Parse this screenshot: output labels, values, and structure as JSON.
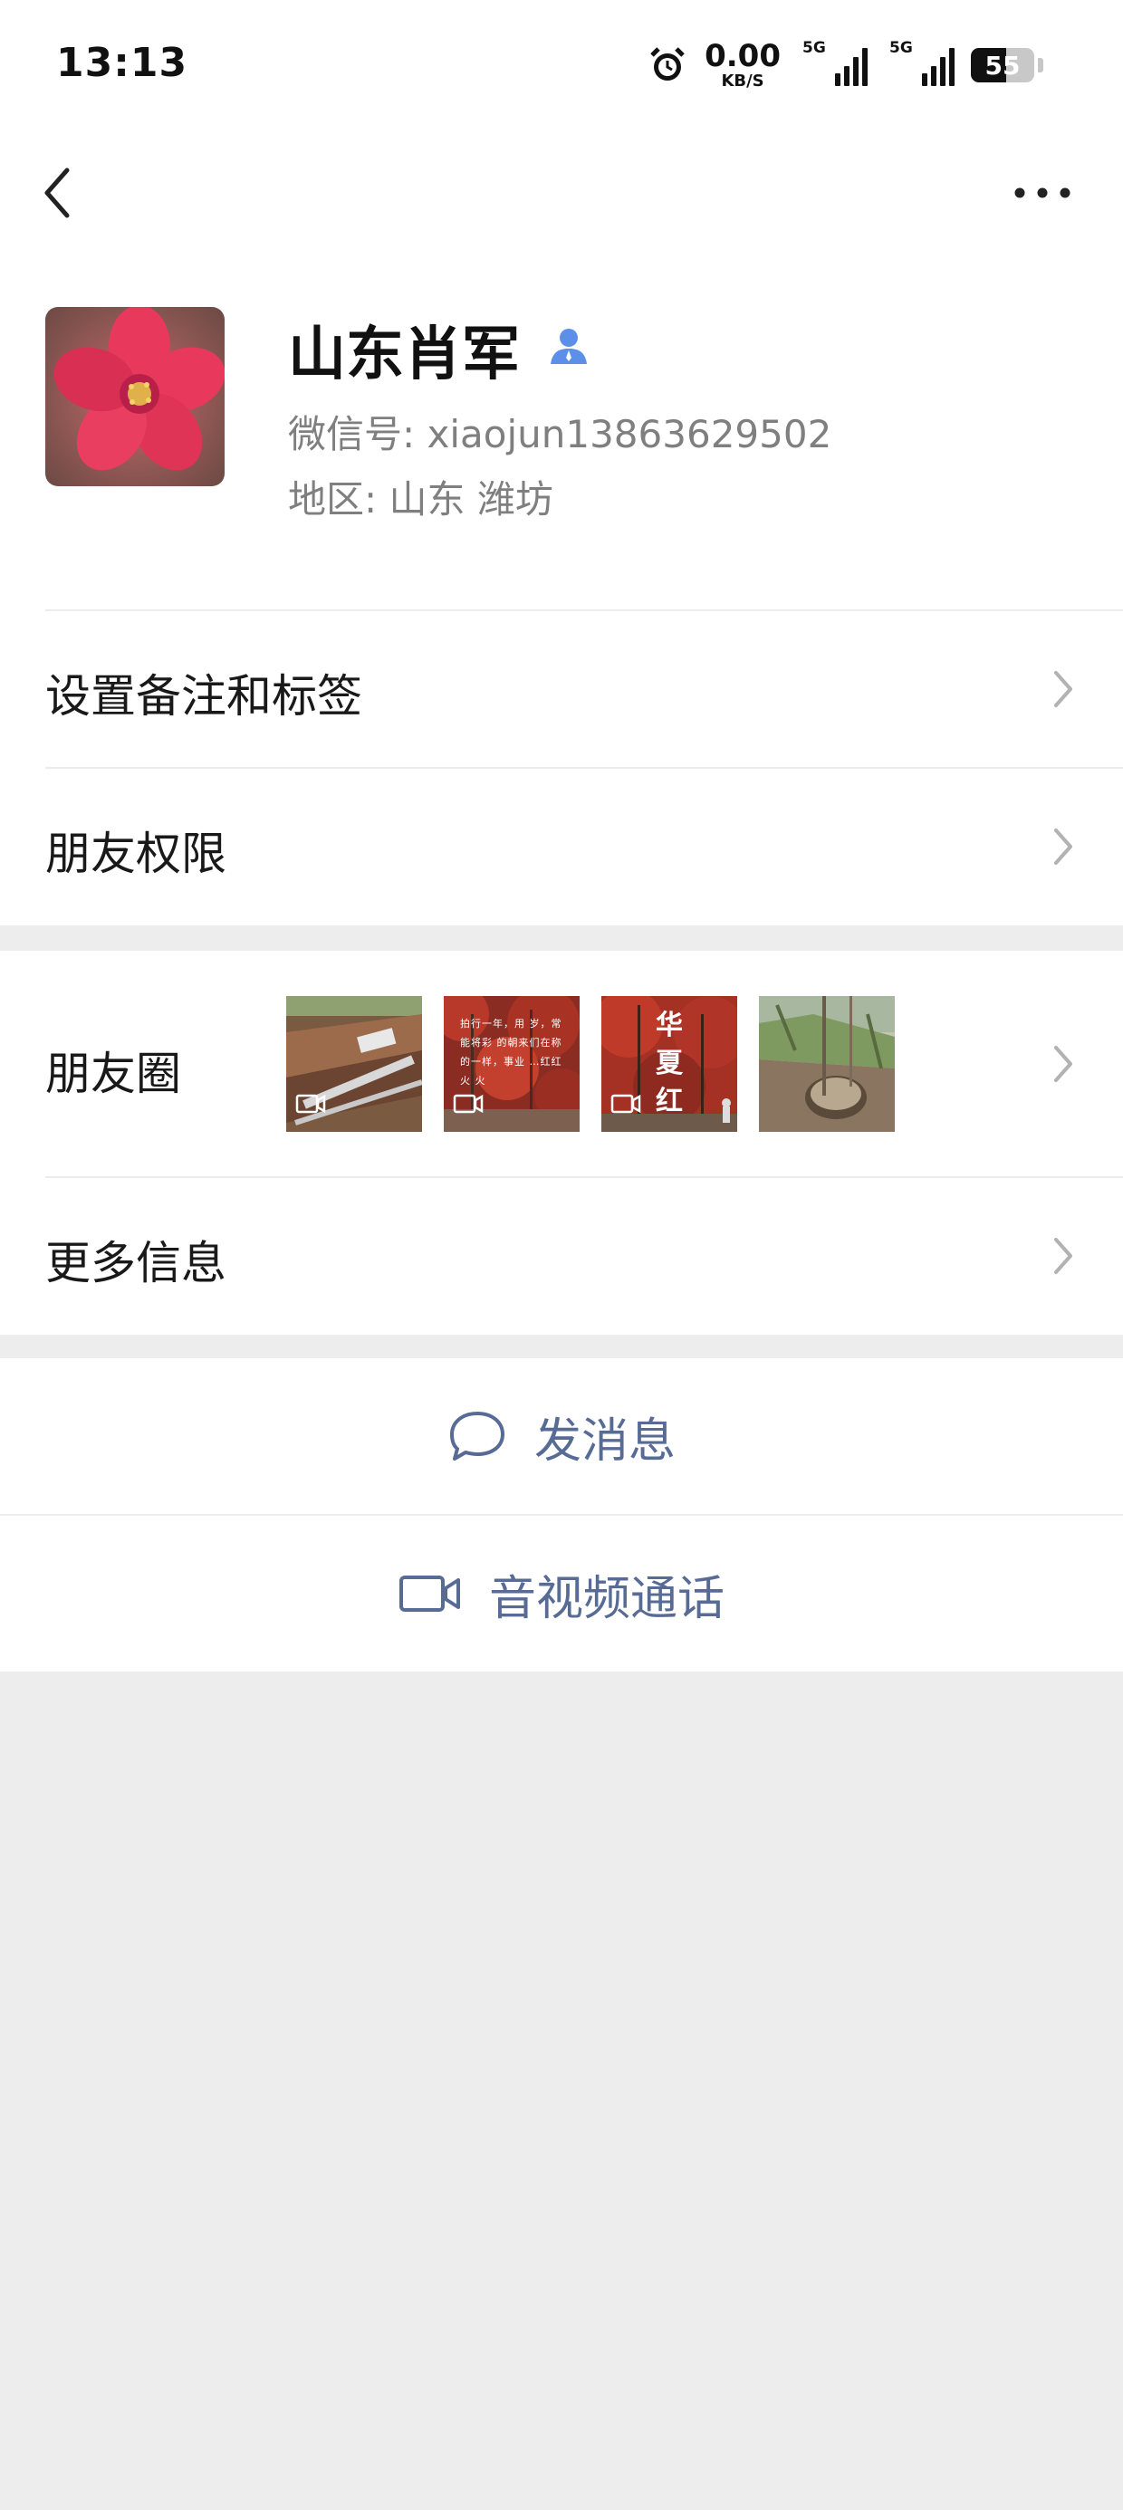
{
  "status_bar": {
    "time": "13:13",
    "speed_value": "0.00",
    "speed_unit": "KB/S",
    "signal1_label": "5G",
    "signal2_label": "5G",
    "battery": "55",
    "battery_level": 0.55
  },
  "profile": {
    "name": "山东肖军",
    "wechat_id": "微信号: xiaojun13863629502",
    "region": "地区: 山东  潍坊"
  },
  "rows": {
    "remark_tags": "设置备注和标签",
    "friend_permissions": "朋友权限",
    "moments": "朋友圈",
    "more_info": "更多信息"
  },
  "moments_thumbs": [
    {
      "type": "video",
      "caption": ""
    },
    {
      "type": "video",
      "caption": "拍行一年，用 岁，常能将彩 的朝来们在称 的一样，事业 …红红火 火"
    },
    {
      "type": "video",
      "caption": "华 夏 红"
    },
    {
      "type": "image",
      "caption": ""
    }
  ],
  "actions": {
    "send_message": "发消息",
    "video_call": "音视频通话"
  },
  "colors": {
    "link_blue": "#576b95",
    "background_gray": "#ededed",
    "verified_icon": "#5b8fe8"
  }
}
